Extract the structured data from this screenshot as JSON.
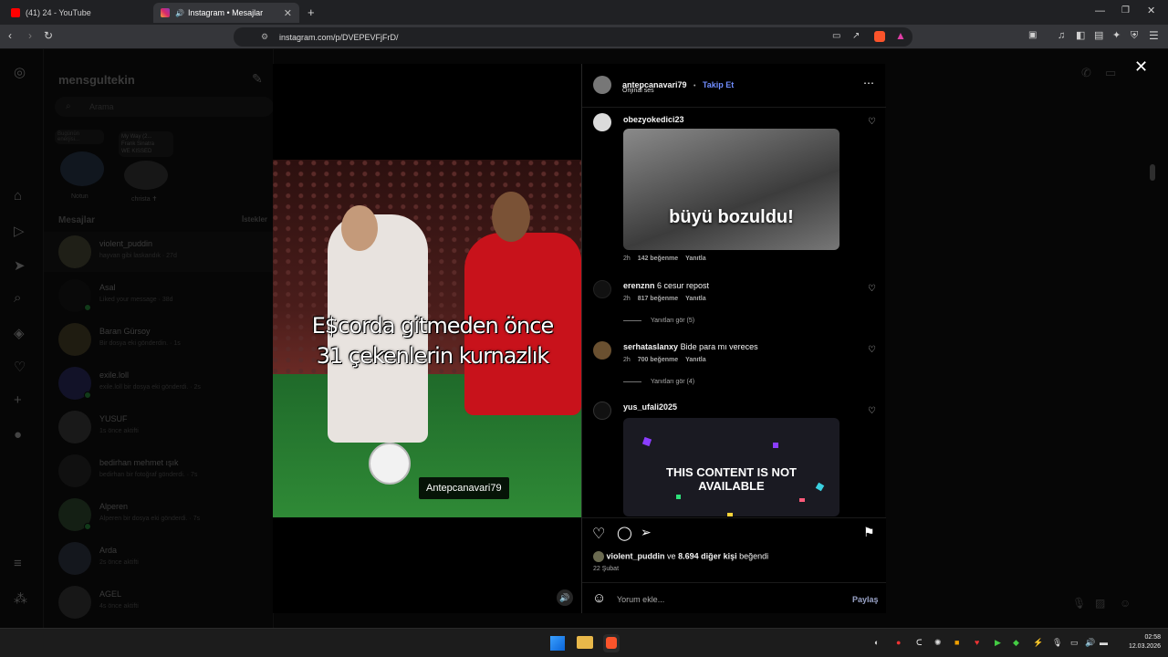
{
  "browser": {
    "tabs": [
      {
        "title": "(41) 24 - YouTube",
        "active": false
      },
      {
        "title": "Instagram • Mesajlar",
        "active": true
      }
    ],
    "url": "instagram.com/p/DVEPEVFjFrD/"
  },
  "sidebar": {
    "account": "mensgultekin",
    "search_placeholder": "Arama",
    "notes": [
      {
        "note": "Bugünün enerjisi...",
        "label": "Notun"
      },
      {
        "note": "My Way (2...",
        "note_sub": "Frank Sinatra",
        "note_sub2": "WE KISSED",
        "label": "christa ✝"
      }
    ],
    "section_title": "Mesajlar",
    "requests_label": "İstekler",
    "conversations": [
      {
        "name": "violent_puddin",
        "sub": "hayvan gibi laskandık · 27d"
      },
      {
        "name": "Asal",
        "sub": "Liked your message · 38d"
      },
      {
        "name": "Baran Gürsoy",
        "sub": "Bir dosya eki gönderdin. · 1s"
      },
      {
        "name": "exile.loll",
        "sub": "exile.loll bir dosya eki gönderdi. · 2s"
      },
      {
        "name": "YUSUF",
        "sub": "1s önce aktifti"
      },
      {
        "name": "bedirhan mehmet ışık",
        "sub": "bedirhan bir fotoğraf gönderdi. · 7s"
      },
      {
        "name": "Alperen",
        "sub": "Alperen bir dosya eki gönderdi. · 7s"
      },
      {
        "name": "Arda",
        "sub": "2s önce aktifti"
      },
      {
        "name": "AGEL",
        "sub": "4s önce aktifti"
      }
    ]
  },
  "post": {
    "caption_line1": "E$corda gitmeden önce",
    "caption_line2": "31 çekenlerin kurnazlık",
    "watermark": "Antepcanavari79",
    "author": "antepcanavari79",
    "follow": "Takip Et",
    "audio": "Orijinal ses",
    "comments": [
      {
        "user": "obezyokedici23",
        "gif_text": "büyü bozuldu!",
        "time": "2h",
        "likes": "142 beğenme",
        "reply": "Yanıtla"
      },
      {
        "user": "erenznn",
        "text": "6 cesur repost",
        "time": "2h",
        "likes": "817 beğenme",
        "reply": "Yanıtla",
        "view_replies": "Yanıtları gör (5)"
      },
      {
        "user": "serhataslanxy",
        "text": "Bide para mı vereces",
        "time": "2h",
        "likes": "700 beğenme",
        "reply": "Yanıtla",
        "view_replies": "Yanıtları gör (4)"
      },
      {
        "user": "yus_ufali2025",
        "gif_text": "THIS CONTENT IS NOT AVAILABLE"
      }
    ],
    "liked_by_user": "violent_puddin",
    "liked_by_mid": "ve",
    "liked_by_count": "8.694 diğer kişi",
    "liked_by_suffix": "beğendi",
    "date": "22 Şubat",
    "comment_placeholder": "Yorum ekle...",
    "share_label": "Paylaş"
  },
  "taskbar": {
    "time": "02:58",
    "date": "12.03.2026"
  },
  "colors": {
    "link_blue": "#708dff",
    "ig_bg": "#000000",
    "red_tab": "#ff0000"
  }
}
